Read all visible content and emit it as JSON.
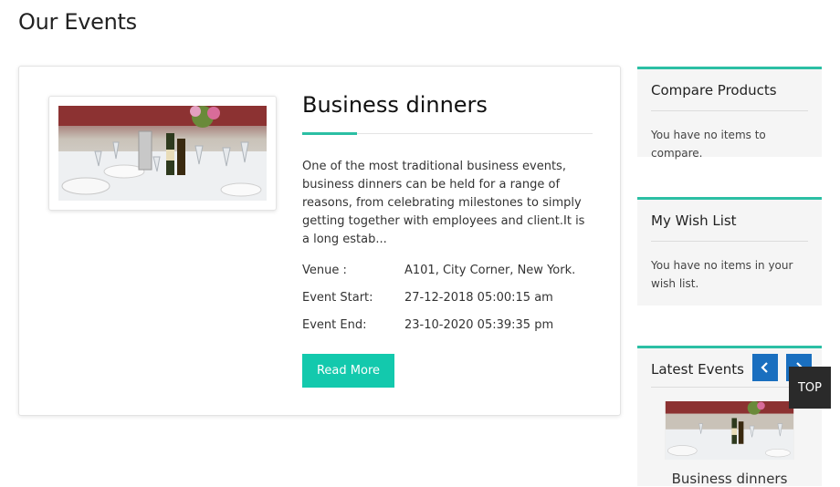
{
  "page": {
    "title": "Our Events"
  },
  "event": {
    "title": "Business dinners",
    "description": "One of the most traditional business events, business dinners can be held for a range of reasons, from celebrating milestones to simply getting together with employees and client.It is a long estab...",
    "details": [
      {
        "label": "Venue :",
        "value": "A101, City Corner, New York."
      },
      {
        "label": "Event Start:",
        "value": "27-12-2018 05:00:15 am"
      },
      {
        "label": "Event End:",
        "value": "23-10-2020 05:39:35 pm"
      }
    ],
    "read_more_label": "Read More",
    "image_icon": "dinner-table-photo"
  },
  "sidebar": {
    "compare": {
      "title": "Compare Products",
      "message": "You have no items to compare."
    },
    "wishlist": {
      "title": "My Wish List",
      "message": "You have no items in your wish list."
    },
    "latest": {
      "title": "Latest Events",
      "prev_icon": "chevron-left-icon",
      "next_icon": "chevron-right-icon",
      "items": [
        {
          "name": "Business dinners"
        }
      ]
    }
  },
  "top_button": {
    "label": "TOP"
  },
  "colors": {
    "accent": "#2bbfa4",
    "button": "#13c9ad",
    "nav": "#1a6fbf",
    "top": "#2a2a2a"
  }
}
